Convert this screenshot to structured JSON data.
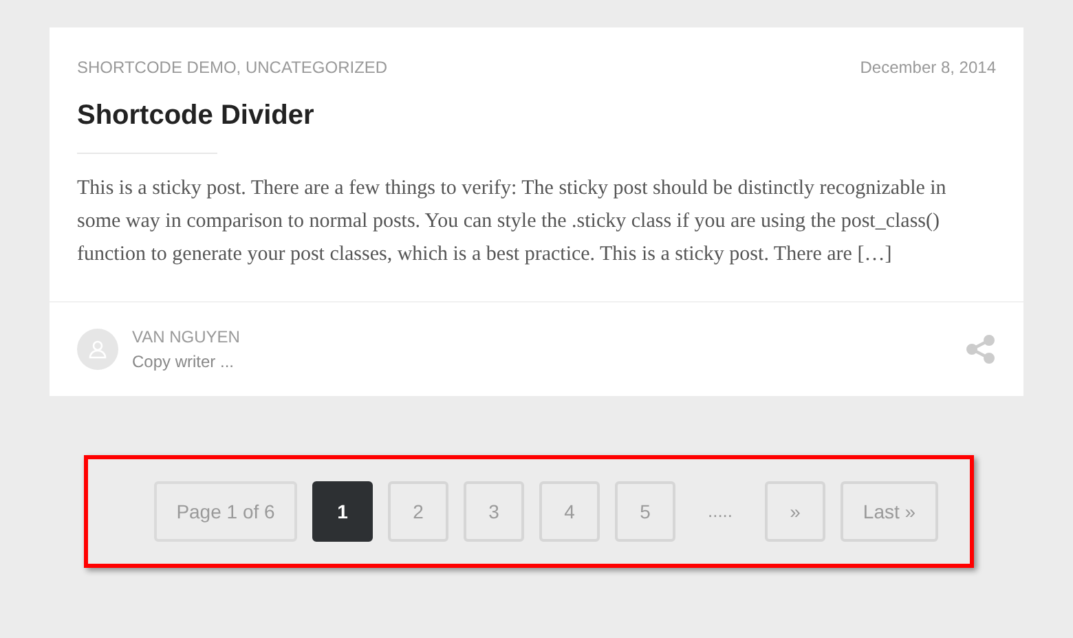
{
  "post": {
    "categories": "SHORTCODE DEMO, UNCATEGORIZED",
    "date": "December 8, 2014",
    "title": "Shortcode Divider",
    "excerpt": "This is a sticky post. There are a few things to verify: The sticky post should be distinctly recognizable in some way in comparison to normal posts. You can style the .sticky class if you are using the post_class() function to generate your post classes, which is a best practice. This is a sticky post. There are […]",
    "author": {
      "name": "VAN NGUYEN",
      "role": "Copy writer ..."
    }
  },
  "pagination": [
    {
      "kind": "info",
      "label": "Page 1 of 6"
    },
    {
      "kind": "page",
      "label": "1",
      "selected": true
    },
    {
      "kind": "page",
      "label": "2",
      "selected": false
    },
    {
      "kind": "page",
      "label": "3",
      "selected": false
    },
    {
      "kind": "page",
      "label": "4",
      "selected": false
    },
    {
      "kind": "page",
      "label": "5",
      "selected": false
    },
    {
      "kind": "dots",
      "label": "....."
    },
    {
      "kind": "page",
      "label": "»",
      "selected": false
    },
    {
      "kind": "page",
      "label": "Last »",
      "selected": false
    }
  ]
}
